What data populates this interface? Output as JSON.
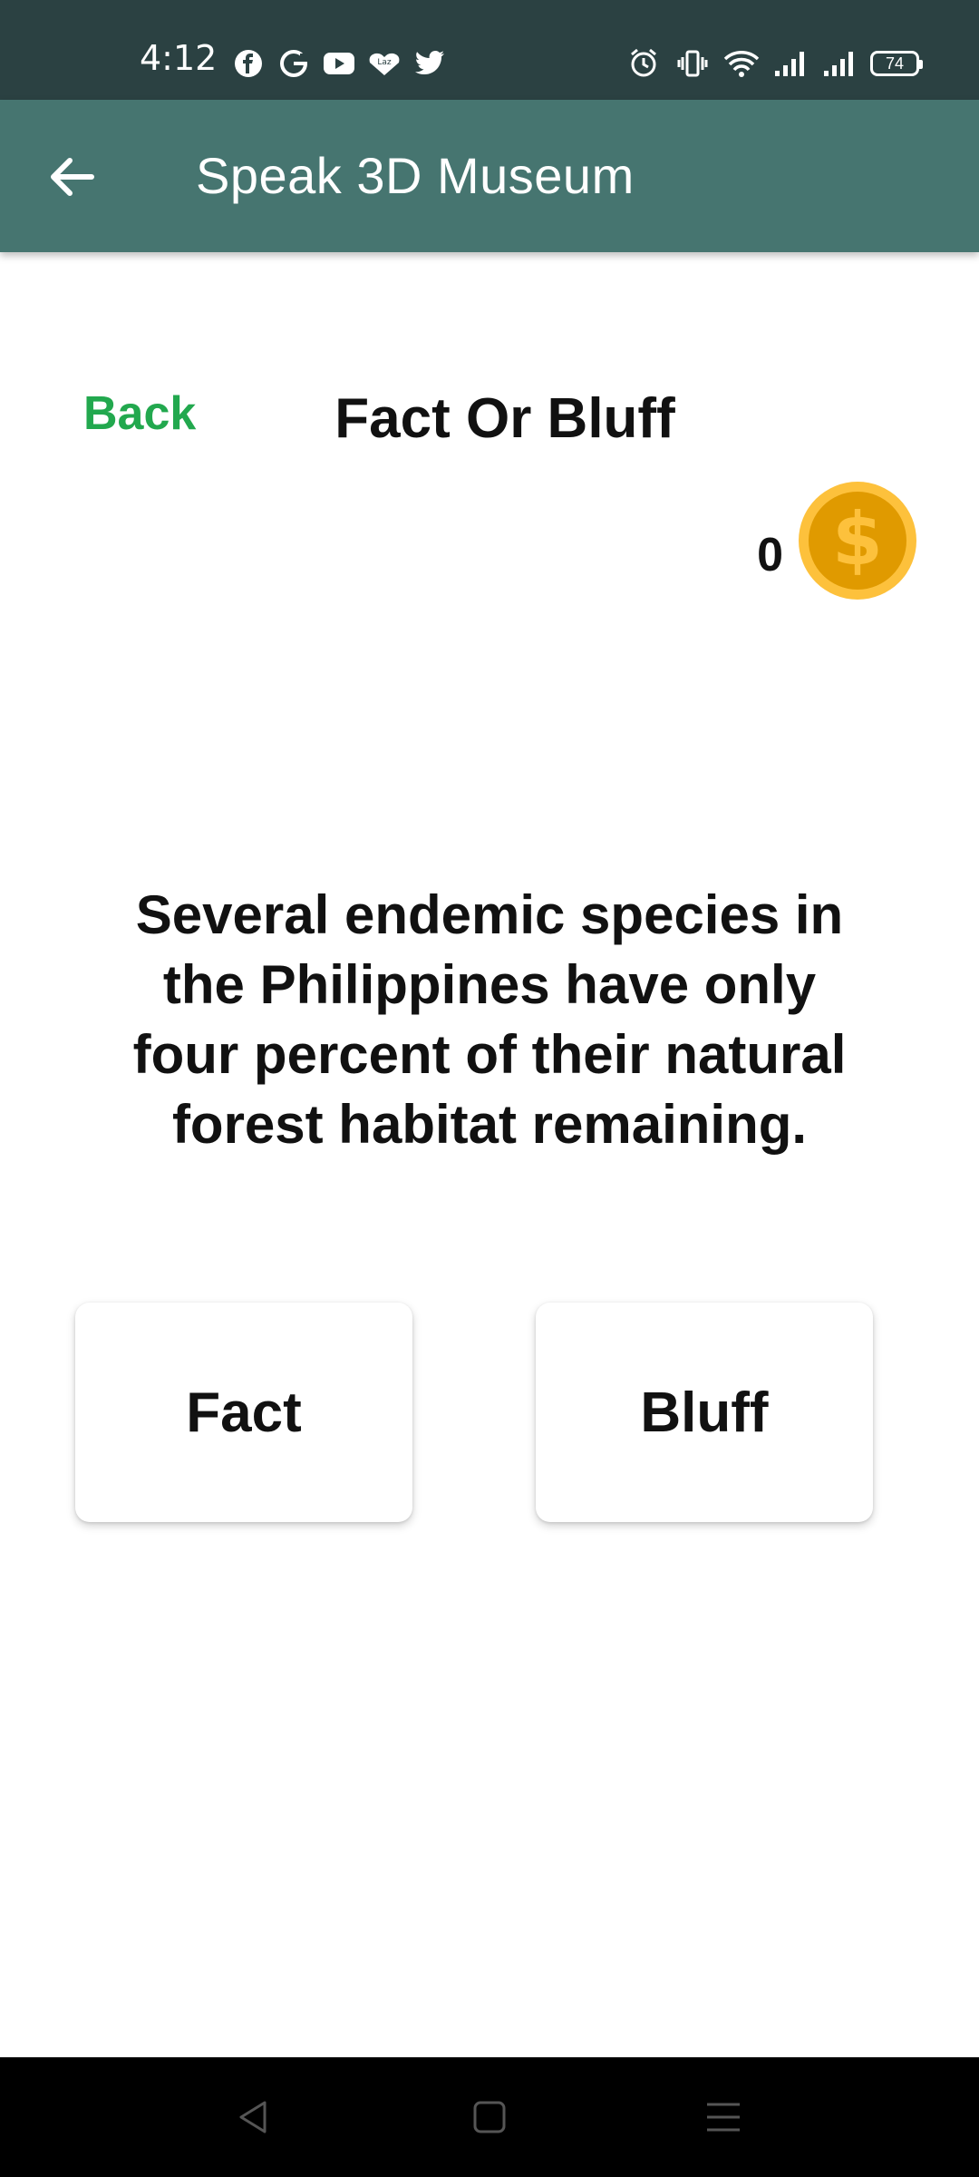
{
  "status_bar": {
    "time": "4:12",
    "left_icons": [
      "facebook-icon",
      "google-icon",
      "youtube-icon",
      "lazada-icon",
      "twitter-icon"
    ],
    "right_icons": [
      "alarm-icon",
      "vibrate-icon",
      "wifi-icon",
      "signal-icon",
      "signal-icon"
    ],
    "battery": "74"
  },
  "app_bar": {
    "title": "Speak 3D Museum",
    "background": "#467570"
  },
  "header": {
    "back_label": "Back",
    "title": "Fact Or Bluff"
  },
  "coins": {
    "count": "0",
    "icon": "dollar-coin-icon",
    "coin_color": "#e09a00"
  },
  "question": {
    "text": "Several endemic species in the Philippines have only four percent of their natural forest habitat remaining."
  },
  "answers": {
    "fact_label": "Fact",
    "bluff_label": "Bluff"
  },
  "nav_bar": {
    "buttons": [
      "back-triangle-icon",
      "home-square-icon",
      "menu-lines-icon"
    ]
  },
  "colors": {
    "accent_green": "#22a84e",
    "status_bar": "#2b4142"
  }
}
